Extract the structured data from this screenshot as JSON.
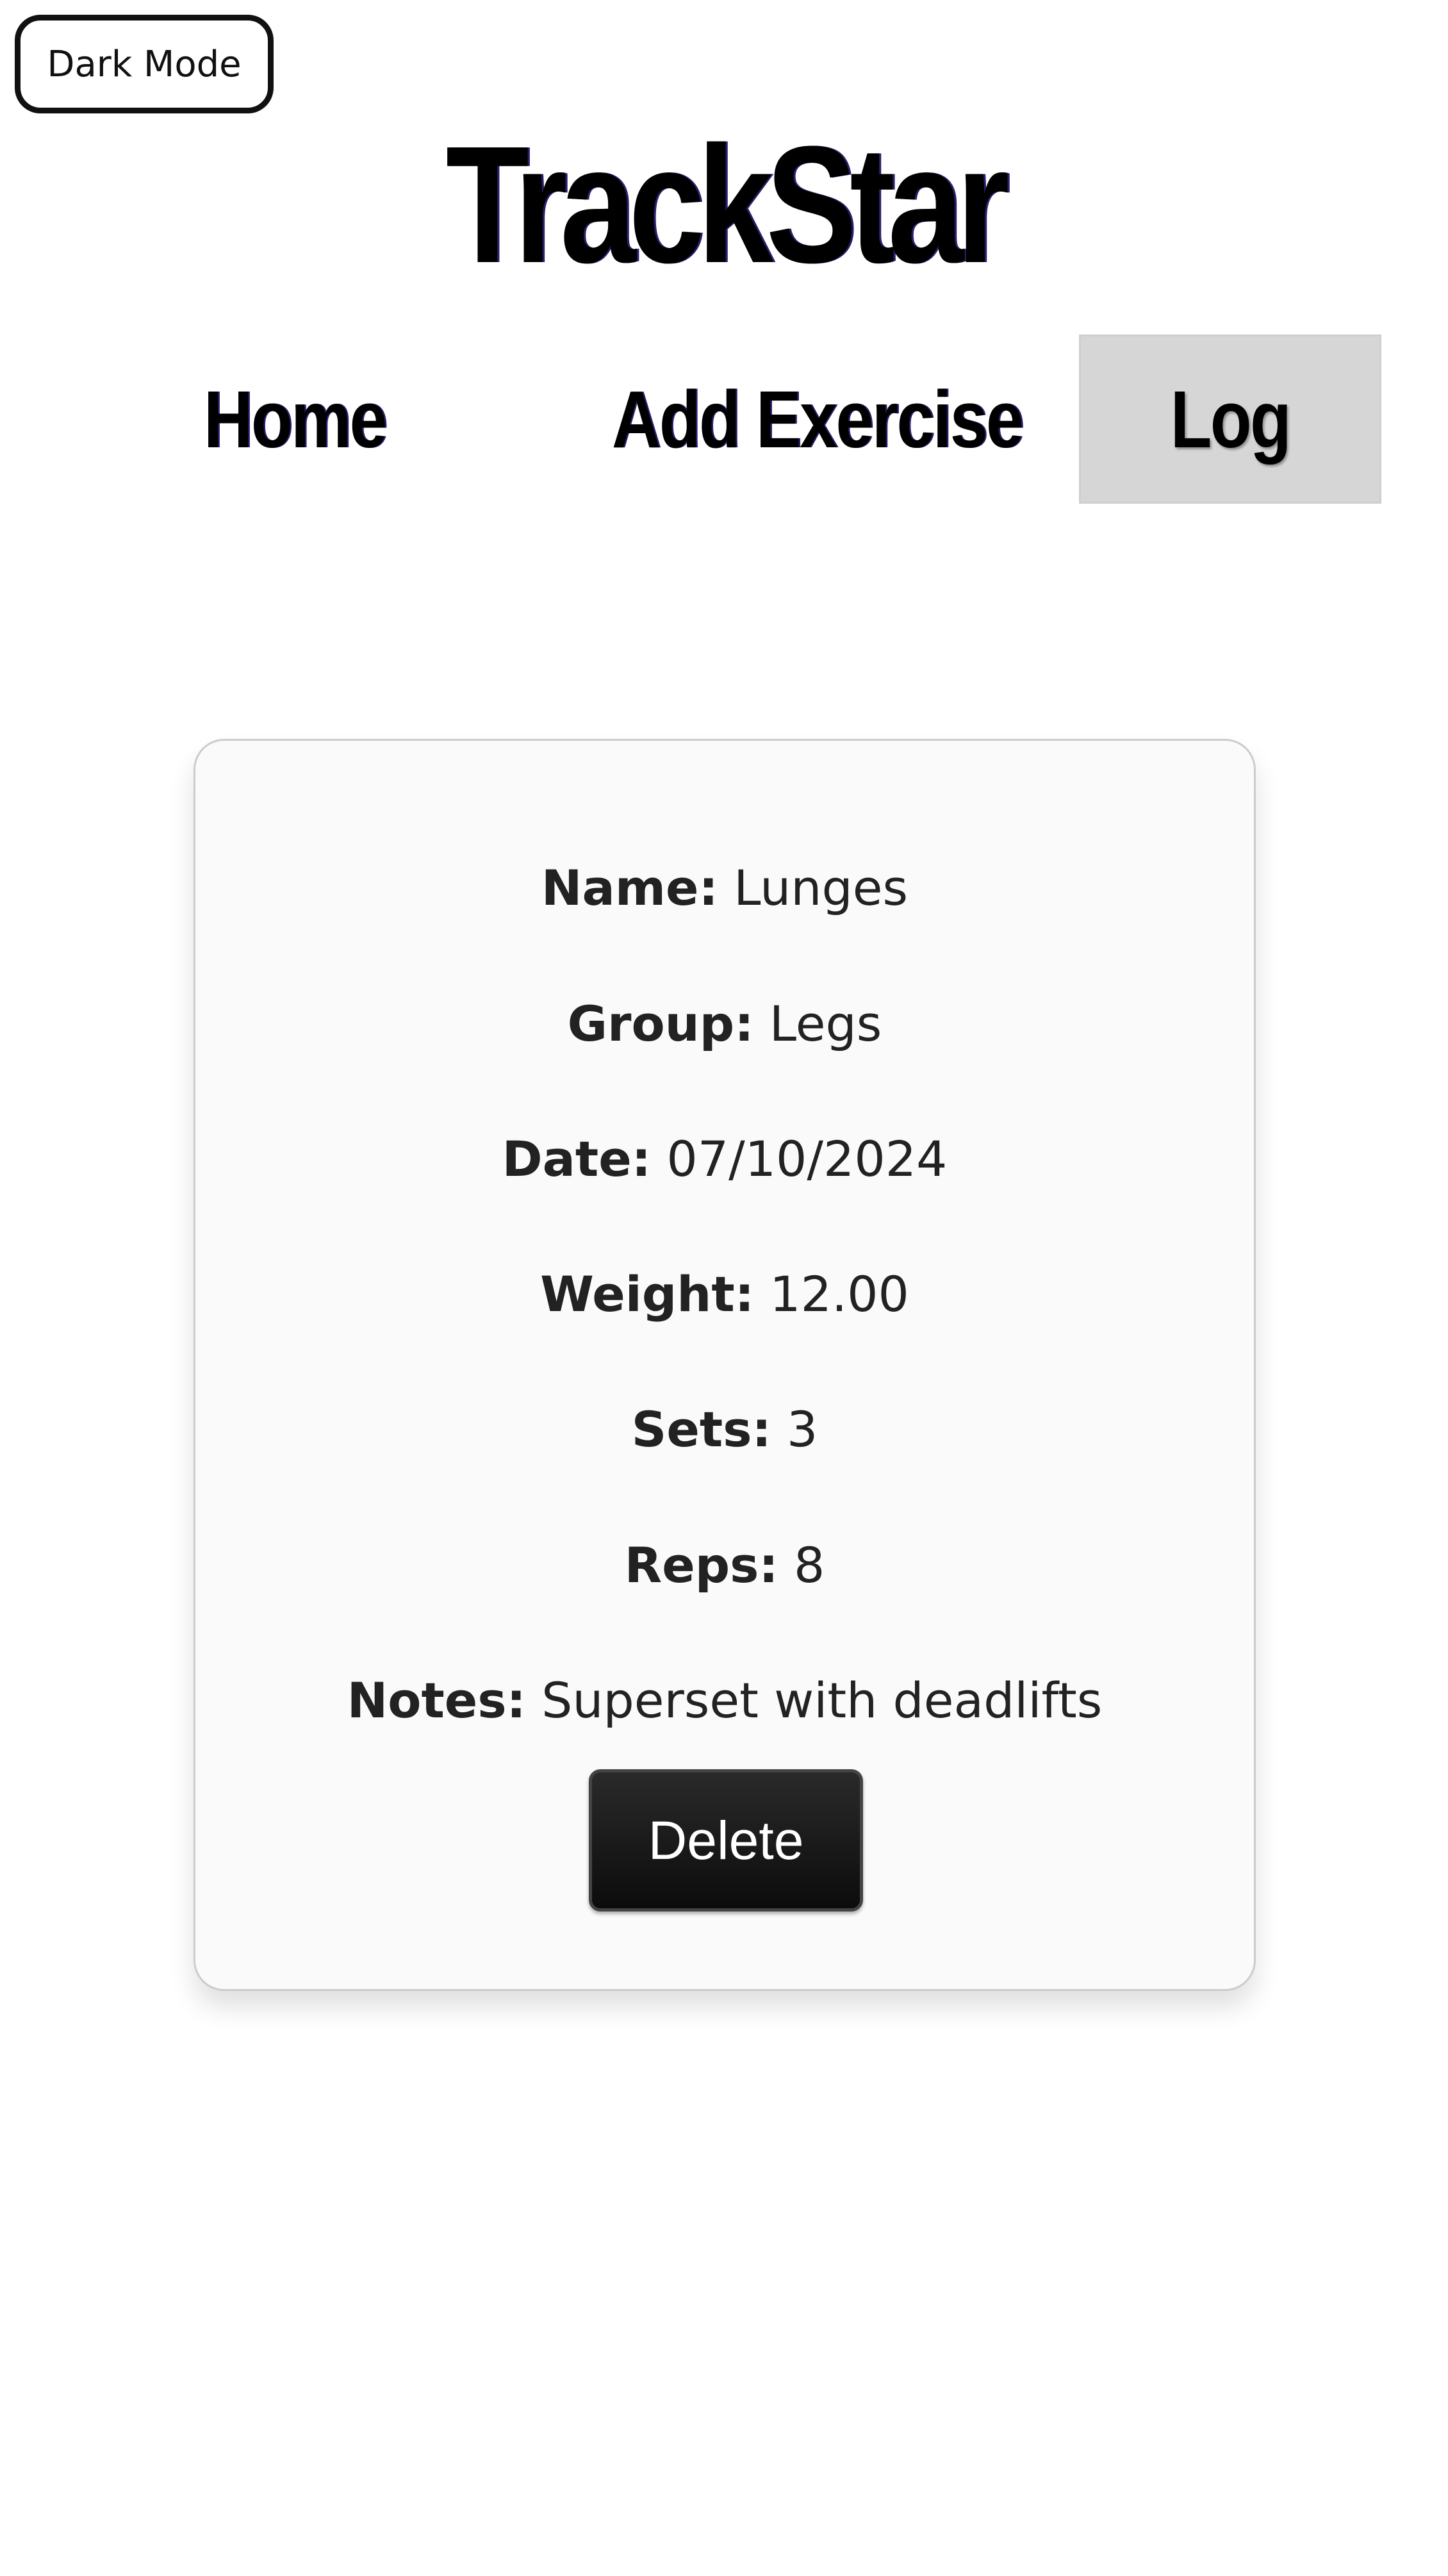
{
  "header": {
    "dark_mode_label": "Dark Mode",
    "brand": "TrackStar"
  },
  "nav": {
    "items": [
      {
        "label": "Home",
        "active": false
      },
      {
        "label": "Add Exercise",
        "active": false
      },
      {
        "label": "Log",
        "active": true
      }
    ]
  },
  "entry": {
    "fields": [
      {
        "label": "Name:",
        "value": "Lunges"
      },
      {
        "label": "Group:",
        "value": "Legs"
      },
      {
        "label": "Date:",
        "value": "07/10/2024"
      },
      {
        "label": "Weight:",
        "value": "12.00"
      },
      {
        "label": "Sets:",
        "value": "3"
      },
      {
        "label": "Reps:",
        "value": "8"
      },
      {
        "label": "Notes:",
        "value": "Superset with deadlifts"
      }
    ],
    "delete_label": "Delete"
  },
  "colors": {
    "active_tab_bg": "#d6d6d6",
    "card_bg": "#fafafa",
    "button_bg": "#111111",
    "text": "#222222"
  }
}
